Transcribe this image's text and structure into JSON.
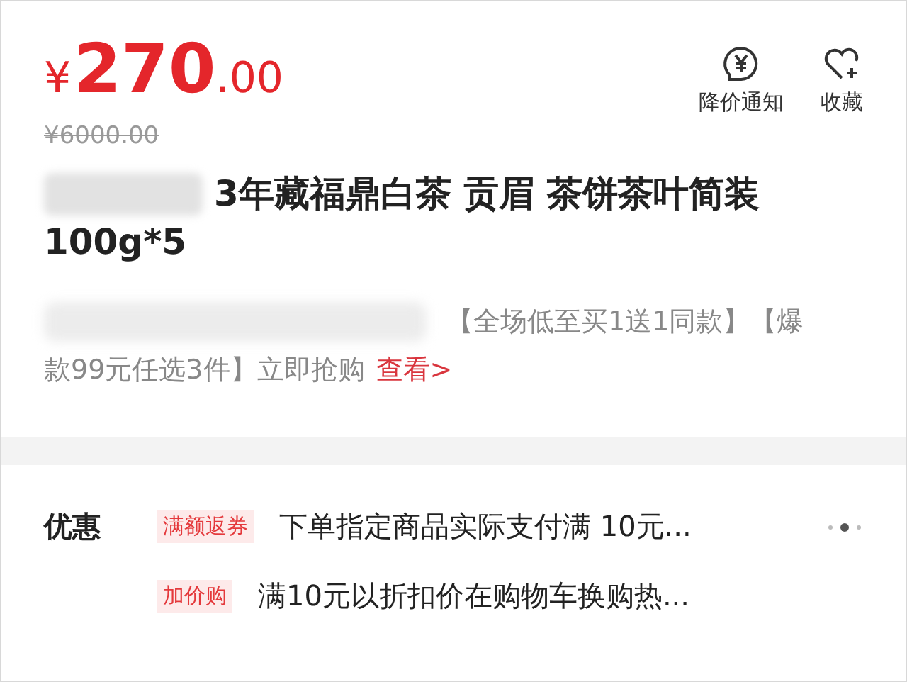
{
  "price": {
    "currency": "¥",
    "integer": "270",
    "decimal": ".00"
  },
  "original_price": "¥6000.00",
  "actions": [
    {
      "kind": "price-alert",
      "label": "降价通知"
    },
    {
      "kind": "favorite",
      "label": "收藏"
    }
  ],
  "title_lines": [
    "3年藏福鼎白茶 贡眉 茶饼茶叶简装",
    "100g*5"
  ],
  "subtitle": {
    "lines": [
      "【全场低至买1送1同款】【爆",
      "款99元任选3件】立即抢购"
    ],
    "link": "查看>"
  },
  "promotions": {
    "heading": "优惠",
    "items": [
      {
        "tag": "满额返券",
        "text": "下单指定商品实际支付满 10元..."
      },
      {
        "tag": "加价购",
        "text": "满10元以折扣价在购物车换购热..."
      }
    ]
  }
}
